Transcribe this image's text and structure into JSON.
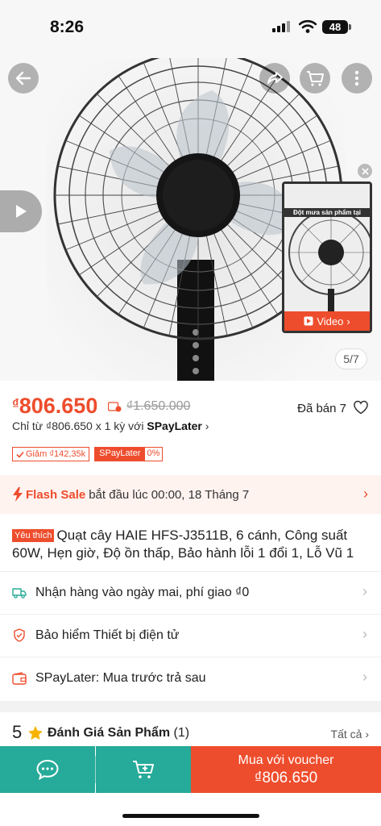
{
  "status_bar": {
    "time": "8:26",
    "battery": "48"
  },
  "gallery": {
    "video_banner": "Đột mưa sản phẩm tại",
    "video_label": "Video",
    "counter": "5/7"
  },
  "price": {
    "currency": "₫",
    "current": "806.650",
    "original": "₫1.650.000",
    "sold": "Đã bán 7",
    "spaylater_prefix": "Chỉ từ ₫806.650 x 1 kỳ với ",
    "spaylater_brand": "SPayLater",
    "spaylater_chevron": "›"
  },
  "tags": {
    "discount": "Giảm ₫142,35k",
    "spay_label": "SPayLater",
    "spay_rate": "0%"
  },
  "flash_sale": {
    "label": "Flash Sale",
    "text": "bắt đầu lúc 00:00, 18 Tháng 7",
    "chevron": "›"
  },
  "product": {
    "badge": "Yêu thích",
    "title": "Quạt cây HAIE HFS-J3511B, 6 cánh, Công suất 60W, Hẹn giờ, Độ ồn thấp, Bảo hành lỗi 1 đổi 1, Lỗ Vũ 1"
  },
  "info_rows": [
    {
      "icon": "truck-icon",
      "label": "Nhận hàng vào ngày mai, phí giao ₫0"
    },
    {
      "icon": "shield-icon",
      "label": "Bảo hiểm Thiết bị điện tử"
    },
    {
      "icon": "wallet-icon",
      "label": "SPayLater: Mua trước trả sau"
    }
  ],
  "row_chevron": "›",
  "reviews": {
    "rating": "5",
    "title": "Đánh Giá Sản Phẩm",
    "count": "(1)",
    "see_all": "Tất cả ›"
  },
  "bottom_bar": {
    "buy_line1": "Mua với voucher",
    "buy_line2": "₫806.650"
  },
  "colors": {
    "brand": "#ee4d2d",
    "teal": "#26aa99"
  }
}
